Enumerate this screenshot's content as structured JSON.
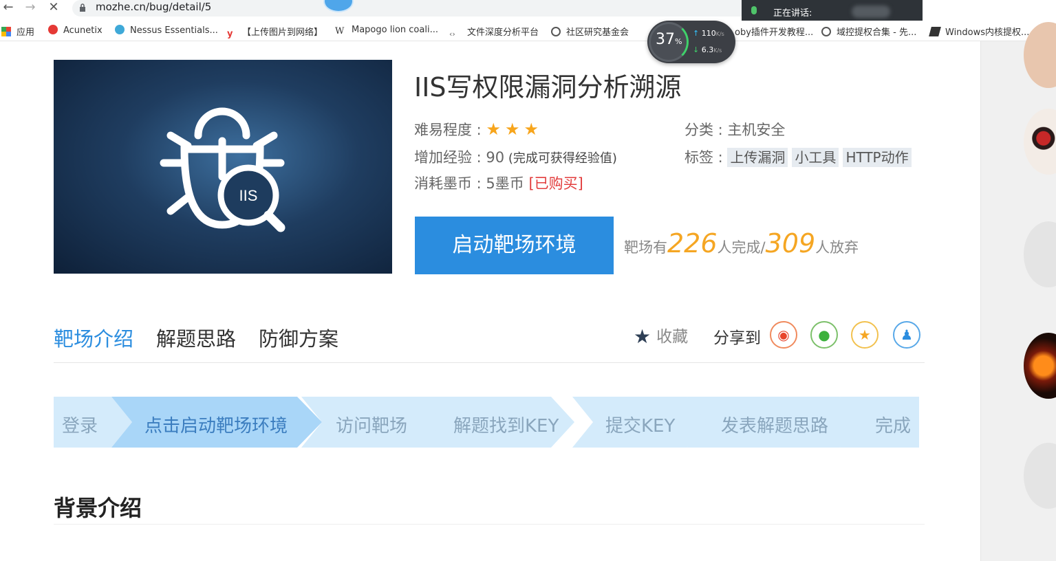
{
  "browser": {
    "url": "mozhe.cn/bug/detail/5",
    "voice_label": "正在讲话:",
    "bookmarks": [
      {
        "label": "应用",
        "icon": "apps-grid-icon"
      },
      {
        "label": "Acunetix",
        "icon": "acunetix-icon"
      },
      {
        "label": "Nessus Essentials...",
        "icon": "nessus-icon"
      },
      {
        "label": "【上传图片到网络】",
        "icon": "y-icon"
      },
      {
        "label": "Mapogo lion coali...",
        "icon": "wikipedia-icon"
      },
      {
        "label": "文件深度分析平台",
        "icon": "code-icon"
      },
      {
        "label": "社区研究基金会",
        "icon": "globe-icon"
      },
      {
        "label": "oby插件开发教程...",
        "icon": "red-icon"
      },
      {
        "label": "域控提权合集 - 先...",
        "icon": "globe-icon"
      },
      {
        "label": "Windows内核提权...",
        "icon": "bookmark-icon"
      }
    ]
  },
  "speed_widget": {
    "percent": "37",
    "percent_unit": "%",
    "up_value": "110",
    "up_unit": "K/s",
    "down_value": "6.3",
    "down_unit": "K/s"
  },
  "challenge": {
    "title": "IIS写权限漏洞分析溯源",
    "banner_text": "IIS",
    "difficulty_label": "难易程度 : ",
    "difficulty_stars": "★★★",
    "exp_label": "增加经验 : 90",
    "exp_note": " (完成可获得经验值)",
    "cost_label": "消耗墨币 : 5墨币 ",
    "cost_status": "[已购买]",
    "category_label": "分类 : 主机安全",
    "tags_label": "标签 : ",
    "tags": [
      "上传漏洞",
      "小工具",
      "HTTP动作"
    ],
    "start_button": "启动靶场环境",
    "stats_prefix": "靶场有",
    "completed": "226",
    "completed_suffix": "人完成/",
    "abandoned": "309",
    "abandoned_suffix": "人放弃"
  },
  "tabs": [
    "靶场介绍",
    "解题思路",
    "防御方案"
  ],
  "actions": {
    "collect_label": "收藏",
    "share_label": "分享到"
  },
  "steps": [
    "登录",
    "点击启动靶场环境",
    "访问靶场",
    "解题找到KEY",
    "提交KEY",
    "发表解题思路",
    "完成"
  ],
  "section_title": "背景介绍",
  "colors": {
    "accent": "#2b8ddf",
    "star": "#f7a51c",
    "count": "#f5a623",
    "purchased": "#e23c3c"
  }
}
